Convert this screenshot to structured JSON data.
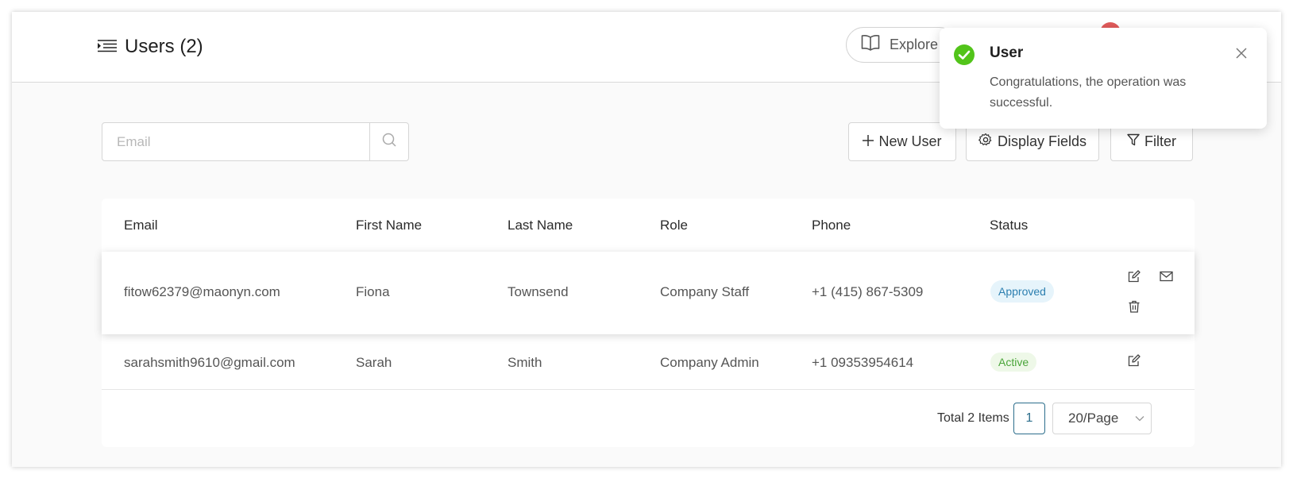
{
  "header": {
    "title": "Users (2)",
    "explore_label": "Explore"
  },
  "search": {
    "placeholder": "Email",
    "value": ""
  },
  "toolbar": {
    "new_user_label": "New User",
    "display_fields_label": "Display Fields",
    "filter_label": "Filter"
  },
  "table": {
    "columns": [
      "Email",
      "First Name",
      "Last Name",
      "Role",
      "Phone",
      "Status"
    ],
    "rows": [
      {
        "email": "fitow62379@maonyn.com",
        "first_name": "Fiona",
        "last_name": "Townsend",
        "role": "Company Staff",
        "phone": "+1 (415) 867-5309",
        "status": "Approved"
      },
      {
        "email": "sarahsmith9610@gmail.com",
        "first_name": "Sarah",
        "last_name": "Smith",
        "role": "Company Admin",
        "phone": "+1 09353954614",
        "status": "Active"
      }
    ]
  },
  "pagination": {
    "total_label": "Total 2 Items",
    "current_page": "1",
    "page_size": "20/Page"
  },
  "toast": {
    "title": "User",
    "message": "Congratulations, the operation was successful."
  },
  "colors": {
    "accent": "#2c6e8c",
    "success": "#52c41a",
    "approved_bg": "#e6f4fb",
    "approved_text": "#2c7fb0",
    "active_bg": "#eef8e8",
    "active_text": "#4aa53a",
    "notification_dot": "#e05a5a"
  },
  "icons": {
    "menu": "menu-lines-icon",
    "explore": "book-open-icon",
    "search": "search-icon",
    "new_user": "plus-icon",
    "display_fields": "gear-icon",
    "filter": "filter-icon",
    "edit": "edit-icon",
    "email": "mail-icon",
    "delete": "trash-icon",
    "toast_status": "check-circle-icon",
    "toast_close": "close-icon",
    "page_size": "chevron-down-icon"
  }
}
